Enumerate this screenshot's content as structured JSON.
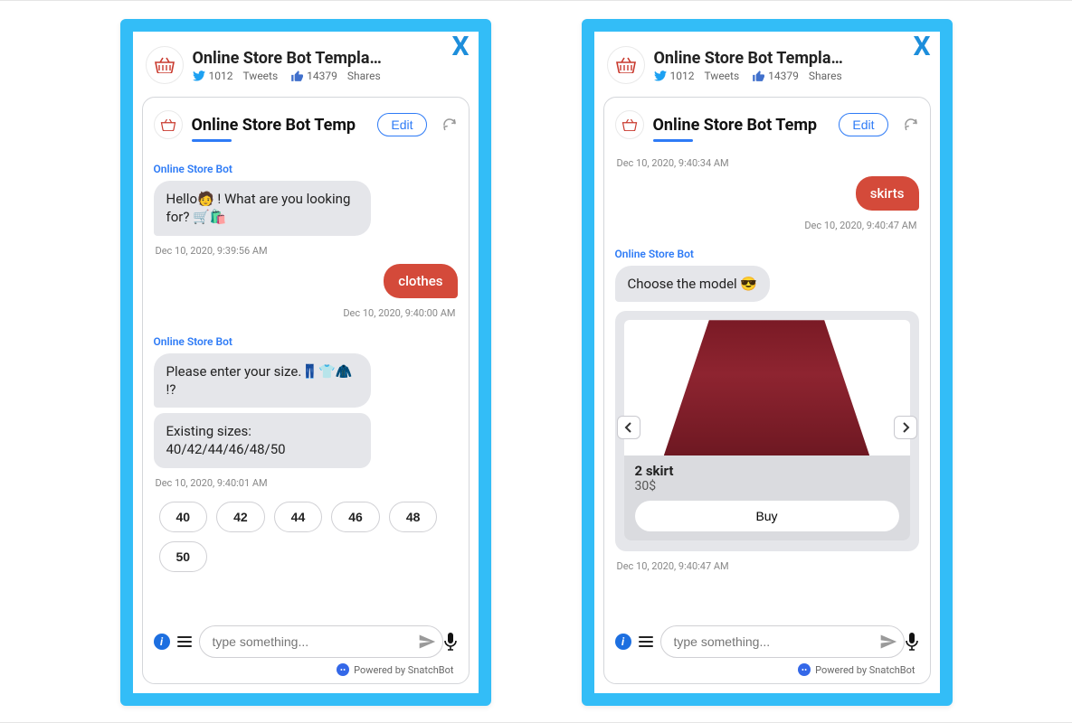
{
  "header": {
    "title": "Online Store Bot Templa…",
    "tweets_count": "1012",
    "tweets_label": "Tweets",
    "shares_count": "14379",
    "shares_label": "Shares"
  },
  "card": {
    "title": "Online Store Bot Temp",
    "edit_label": "Edit"
  },
  "left_chat": {
    "bot_name": "Online Store Bot",
    "msg1": "Hello🧑 ! What are you looking for? 🛒🛍️",
    "ts1": "Dec 10, 2020, 9:39:56 AM",
    "user1": "clothes",
    "ts2": "Dec 10, 2020, 9:40:00 AM",
    "msg2": "Please enter your size.👖👕🧥 !?",
    "msg3": "Existing sizes: 40/42/44/46/48/50",
    "ts3": "Dec 10, 2020, 9:40:01 AM",
    "sizes": [
      "40",
      "42",
      "44",
      "46",
      "48",
      "50"
    ]
  },
  "right_chat": {
    "ts_top": "Dec 10, 2020, 9:40:34 AM",
    "user1": "skirts",
    "ts1": "Dec 10, 2020, 9:40:47 AM",
    "bot_name": "Online Store Bot",
    "msg1": "Choose the model 😎",
    "product_title": "2 skirt",
    "product_price": "30$",
    "buy_label": "Buy",
    "ts_bottom": "Dec 10, 2020, 9:40:47 AM"
  },
  "input": {
    "placeholder": "type something..."
  },
  "footer": {
    "powered": "Powered by SnatchBot"
  },
  "close_label": "X"
}
